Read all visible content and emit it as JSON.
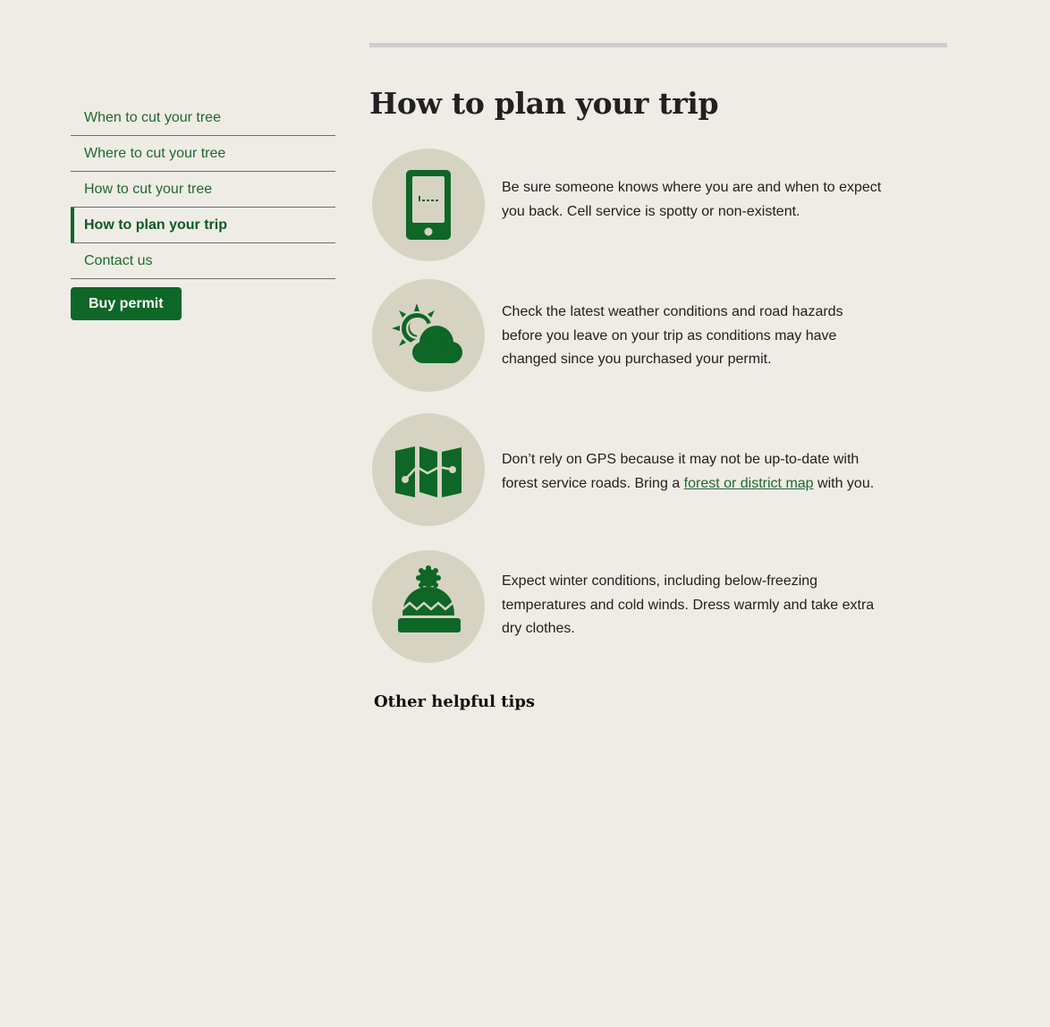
{
  "sidebar": {
    "items": [
      {
        "label": "When to cut your tree",
        "active": false
      },
      {
        "label": "Where to cut your tree",
        "active": false
      },
      {
        "label": "How to cut your tree",
        "active": false
      },
      {
        "label": "How to plan your trip",
        "active": true
      },
      {
        "label": "Contact us",
        "active": false
      }
    ],
    "buy_button": "Buy permit"
  },
  "main": {
    "title": "How to plan your trip",
    "tips": [
      {
        "icon": "cell-phone-icon",
        "text": "Be sure someone knows where you are and when to expect you back. Cell service is spotty or non-existent."
      },
      {
        "icon": "sun-cloud-icon",
        "text": "Check the latest weather conditions and road hazards before you leave on your trip as conditions may have changed since you purchased your permit."
      },
      {
        "icon": "map-icon",
        "text_before": "Don’t rely on GPS because it may not be up-to-date with forest service roads. Bring a ",
        "link": "forest or district map",
        "text_after": " with you."
      },
      {
        "icon": "winter-hat-icon",
        "text": "Expect winter conditions, including below-freezing temperatures and cold winds. Dress warmly and take extra dry clothes."
      }
    ],
    "subheading": "Other helpful tips"
  },
  "colors": {
    "background": "#efece5",
    "brand_green": "#0e6627",
    "link_green": "#1d6a2f",
    "icon_circle": "#d6d3c3"
  }
}
